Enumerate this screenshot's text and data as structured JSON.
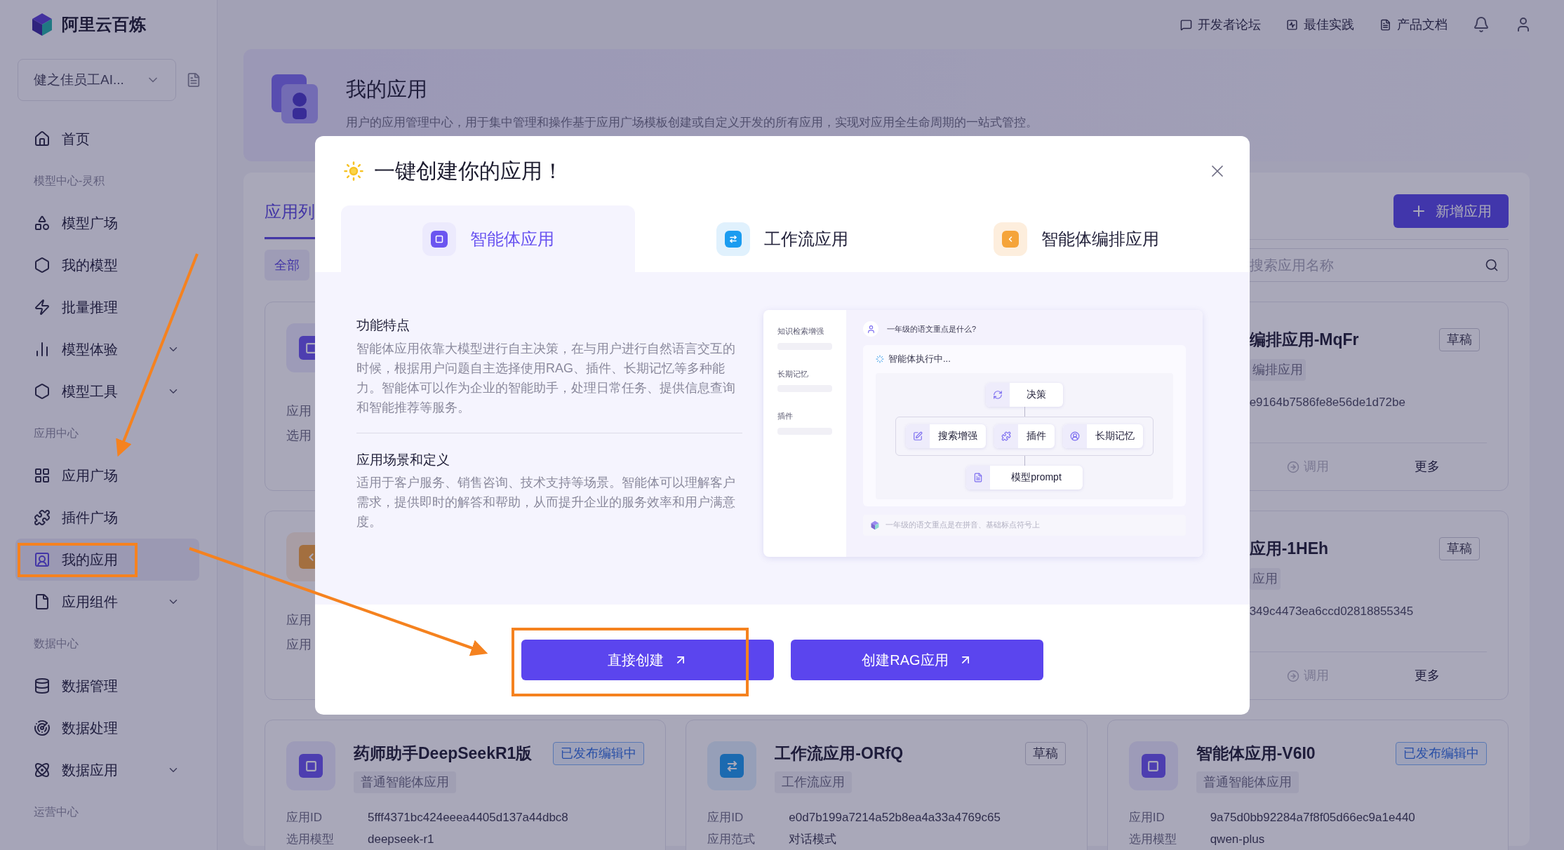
{
  "brand": {
    "name": "阿里云百炼"
  },
  "workspace": {
    "label": "健之佳员工AI..."
  },
  "sidebar": {
    "entries": [
      {
        "kind": "item",
        "label": "首页",
        "selected": false,
        "expandable": false
      },
      {
        "kind": "section",
        "label": "模型中心-灵积"
      },
      {
        "kind": "item",
        "label": "模型广场",
        "selected": false,
        "expandable": false
      },
      {
        "kind": "item",
        "label": "我的模型",
        "selected": false,
        "expandable": false
      },
      {
        "kind": "item",
        "label": "批量推理",
        "selected": false,
        "expandable": false
      },
      {
        "kind": "item",
        "label": "模型体验",
        "selected": false,
        "expandable": true
      },
      {
        "kind": "item",
        "label": "模型工具",
        "selected": false,
        "expandable": true
      },
      {
        "kind": "section",
        "label": "应用中心"
      },
      {
        "kind": "item",
        "label": "应用广场",
        "selected": false,
        "expandable": false
      },
      {
        "kind": "item",
        "label": "插件广场",
        "selected": false,
        "expandable": false
      },
      {
        "kind": "item",
        "label": "我的应用",
        "selected": true,
        "expandable": false
      },
      {
        "kind": "item",
        "label": "应用组件",
        "selected": false,
        "expandable": true
      },
      {
        "kind": "section",
        "label": "数据中心"
      },
      {
        "kind": "item",
        "label": "数据管理",
        "selected": false,
        "expandable": false
      },
      {
        "kind": "item",
        "label": "数据处理",
        "selected": false,
        "expandable": false
      },
      {
        "kind": "item",
        "label": "数据应用",
        "selected": false,
        "expandable": true
      },
      {
        "kind": "section",
        "label": "运营中心"
      }
    ]
  },
  "header": {
    "links": [
      "开发者论坛",
      "最佳实践",
      "产品文档"
    ]
  },
  "banner": {
    "title": "我的应用",
    "description": "用户的应用管理中心，用于集中管理和操作基于应用广场模板创建或自定义开发的所有应用，实现对应用全生命周期的一站式管控。"
  },
  "list": {
    "tab": {
      "label": "应用列",
      "selected": true
    },
    "filter": {
      "label": "全部",
      "selected": true
    },
    "new_button": "新增应用",
    "search": {
      "placeholder": "搜索应用名称"
    }
  },
  "cards": [
    {
      "kind": "left_edge",
      "icon": {
        "kind": "agent"
      },
      "labels": [
        "应用",
        "选用"
      ]
    },
    {
      "kind": "right_edge",
      "title": "编排应用-MqFr",
      "status": {
        "label": "草稿",
        "kind": "draft"
      },
      "type": "编排应用",
      "id": "e9164b7586fe8e56de1d72be",
      "actions": [
        {
          "label": "调用",
          "disabled": true
        },
        {
          "label": "更多",
          "disabled": false
        }
      ]
    },
    {
      "kind": "left_edge",
      "icon": {
        "kind": "orchestration"
      },
      "labels": [
        "应用",
        "应用"
      ]
    },
    {
      "kind": "right_edge",
      "title": "应用-1HEh",
      "status": {
        "label": "草稿",
        "kind": "draft"
      },
      "type": "应用",
      "id": "349c4473ea6ccd02818855345",
      "actions": [
        {
          "label": "调用",
          "disabled": true
        },
        {
          "label": "更多",
          "disabled": false
        }
      ]
    },
    {
      "kind": "full",
      "icon": {
        "kind": "agent"
      },
      "title": "药师助手DeepSeekR1版",
      "status": {
        "label": "已发布编辑中",
        "kind": "published"
      },
      "type": "普通智能体应用",
      "fields": [
        {
          "label": "应用ID",
          "value": "5fff4371bc424eeea4405d137a44dbc8"
        },
        {
          "label": "选用模型",
          "value": "deepseek-r1"
        }
      ]
    },
    {
      "kind": "full",
      "icon": {
        "kind": "workflow"
      },
      "title": "工作流应用-ORfQ",
      "status": {
        "label": "草稿",
        "kind": "draft"
      },
      "type": "工作流应用",
      "fields": [
        {
          "label": "应用ID",
          "value": "e0d7b199a7214a52b8ea4a33a4769c65"
        },
        {
          "label": "应用范式",
          "value": "对话模式"
        }
      ]
    },
    {
      "kind": "full",
      "icon": {
        "kind": "agent"
      },
      "title": "智能体应用-V6I0",
      "status": {
        "label": "已发布编辑中",
        "kind": "published"
      },
      "type": "普通智能体应用",
      "fields": [
        {
          "label": "应用ID",
          "value": "9a75d0bb92284a7f8f05d66ec9a1e440"
        },
        {
          "label": "选用模型",
          "value": "qwen-plus"
        }
      ]
    }
  ],
  "modal": {
    "title": "一键创建你的应用！",
    "tabs": [
      {
        "label": "智能体应用",
        "selected": true,
        "kind": "agent"
      },
      {
        "label": "工作流应用",
        "selected": false,
        "kind": "workflow"
      },
      {
        "label": "智能体编排应用",
        "selected": false,
        "kind": "orchestration"
      }
    ],
    "sections": [
      {
        "heading": "功能特点",
        "text": "智能体应用依靠大模型进行自主决策，在与用户进行自然语言交互的时候，根据用户问题自主选择使用RAG、插件、长期记忆等多种能力。智能体可以作为企业的智能助手，处理日常任务、提供信息查询和智能推荐等服务。"
      },
      {
        "heading": "应用场景和定义",
        "text": "适用于客户服务、销售咨询、技术支持等场景。智能体可以理解客户需求，提供即时的解答和帮助，从而提升企业的服务效率和用户满意度。"
      }
    ],
    "illustration": {
      "side_labels": [
        "知识检索增强",
        "长期记忆",
        "插件"
      ],
      "question": "一年级的语文重点是什么?",
      "status": "智能体执行中...",
      "decision": "决策",
      "tools": [
        "搜索增强",
        "插件",
        "长期记忆"
      ],
      "model": "模型prompt",
      "answer": "一年级的语文重点是在拼音、基础标点符号上"
    },
    "buttons": [
      "直接创建",
      "创建RAG应用"
    ]
  }
}
